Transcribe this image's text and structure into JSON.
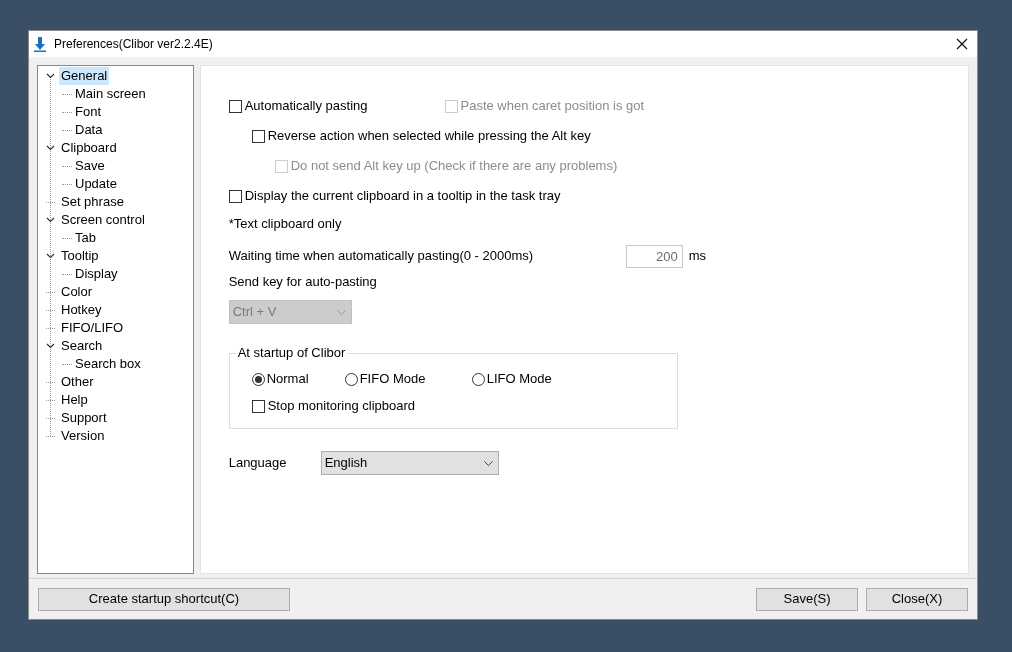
{
  "window": {
    "title": "Preferences(Clibor ver2.2.4E)"
  },
  "tree": [
    {
      "label": "General",
      "selected": true,
      "expanded": true,
      "children": [
        {
          "label": "Main screen",
          "selected": false
        },
        {
          "label": "Font",
          "selected": false
        },
        {
          "label": "Data",
          "selected": false
        }
      ]
    },
    {
      "label": "Clipboard",
      "selected": false,
      "expanded": true,
      "children": [
        {
          "label": "Save",
          "selected": false
        },
        {
          "label": "Update",
          "selected": false
        }
      ]
    },
    {
      "label": "Set phrase",
      "selected": false
    },
    {
      "label": "Screen control",
      "selected": false,
      "expanded": true,
      "children": [
        {
          "label": "Tab",
          "selected": false
        }
      ]
    },
    {
      "label": "Tooltip",
      "selected": false,
      "expanded": true,
      "children": [
        {
          "label": "Display",
          "selected": false
        }
      ]
    },
    {
      "label": "Color",
      "selected": false
    },
    {
      "label": "Hotkey",
      "selected": false
    },
    {
      "label": "FIFO/LIFO",
      "selected": false
    },
    {
      "label": "Search",
      "selected": false,
      "expanded": true,
      "children": [
        {
          "label": "Search box",
          "selected": false
        }
      ]
    },
    {
      "label": "Other",
      "selected": false
    },
    {
      "label": "Help",
      "selected": false
    },
    {
      "label": "Support",
      "selected": false
    },
    {
      "label": "Version",
      "selected": false
    }
  ],
  "options": [
    {
      "label": "Automatically pasting",
      "checked": false,
      "disabled": false,
      "side_option": {
        "label": "Paste when caret position is got",
        "checked": false,
        "disabled": true
      },
      "children": [
        {
          "label": "Reverse action when selected while pressing the Alt key",
          "checked": false,
          "disabled": false,
          "children": [
            {
              "label": "Do not send Alt key up (Check if there are any problems)",
              "checked": false,
              "disabled": true
            }
          ]
        }
      ]
    },
    {
      "label": "Display the current clipboard in a tooltip in the task tray",
      "checked": false,
      "disabled": false
    }
  ],
  "note": "*Text clipboard only",
  "wait_time": {
    "label": "Waiting time when automatically pasting(0 - 2000ms)",
    "value": "200",
    "unit": "ms"
  },
  "send_key": {
    "label": "Send key for auto-pasting",
    "value": "Ctrl + V",
    "disabled": true
  },
  "startup_group": {
    "title": "At startup of Clibor",
    "modes": [
      {
        "label": "Normal",
        "selected": true
      },
      {
        "label": "FIFO Mode",
        "selected": false
      },
      {
        "label": "LIFO Mode",
        "selected": false
      }
    ],
    "stop_monitoring": {
      "label": "Stop monitoring clipboard",
      "checked": false
    }
  },
  "language": {
    "label": "Language",
    "value": "English"
  },
  "buttons": {
    "create_shortcut": "Create startup shortcut(C)",
    "save": "Save(S)",
    "close": "Close(X)"
  }
}
